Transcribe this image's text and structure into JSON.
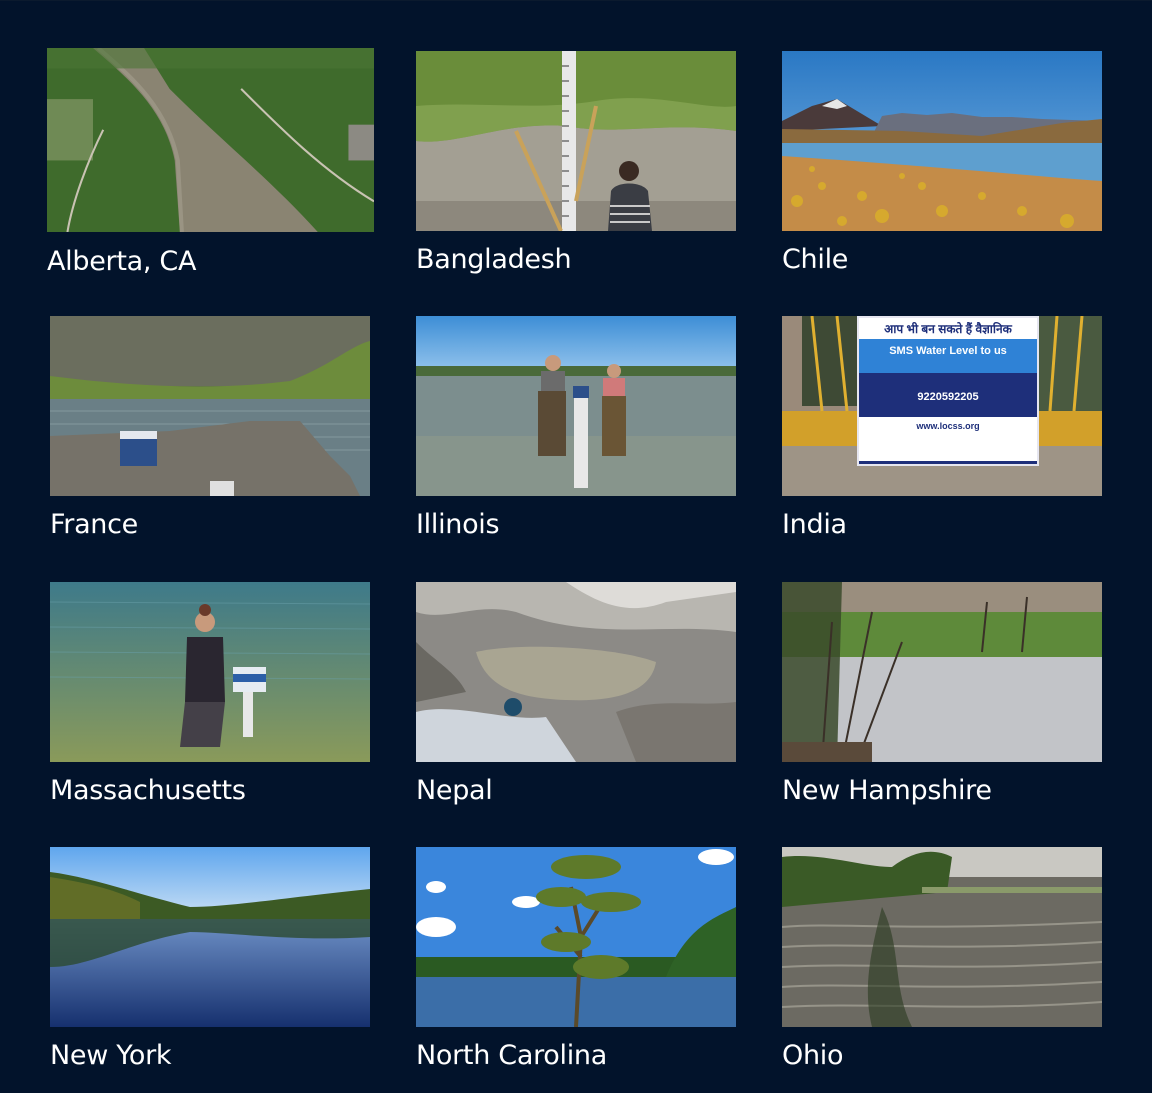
{
  "gallery": {
    "items": [
      {
        "label": "Alberta, CA",
        "image": "aerial river with forested banks and houses"
      },
      {
        "label": "Bangladesh",
        "image": "man beside water gauge in flooded grassy field"
      },
      {
        "label": "Chile",
        "image": "mountain lake in high desert with yellow grass"
      },
      {
        "label": "France",
        "image": "alpine lake with gauge sign on rock"
      },
      {
        "label": "Illinois",
        "image": "two people in waders beside staff gauge in lake"
      },
      {
        "label": "India",
        "image": "SMS Water Level sign at railing"
      },
      {
        "label": "Massachusetts",
        "image": "woman standing in lake beside gauge"
      },
      {
        "label": "Nepal",
        "image": "satellite view of glacial lake"
      },
      {
        "label": "New Hampshire",
        "image": "pond with trees and grass"
      },
      {
        "label": "New York",
        "image": "calm lake reflecting autumn forest"
      },
      {
        "label": "North Carolina",
        "image": "cypress tree over lake"
      },
      {
        "label": "Ohio",
        "image": "rippled water with grassy shore"
      }
    ],
    "india_sign": {
      "hindi_top": "आप भी बन सकते हैं वैज्ञानिक",
      "title": "SMS Water Level to us",
      "number": "9220592205",
      "url": "www.locss.org"
    }
  }
}
